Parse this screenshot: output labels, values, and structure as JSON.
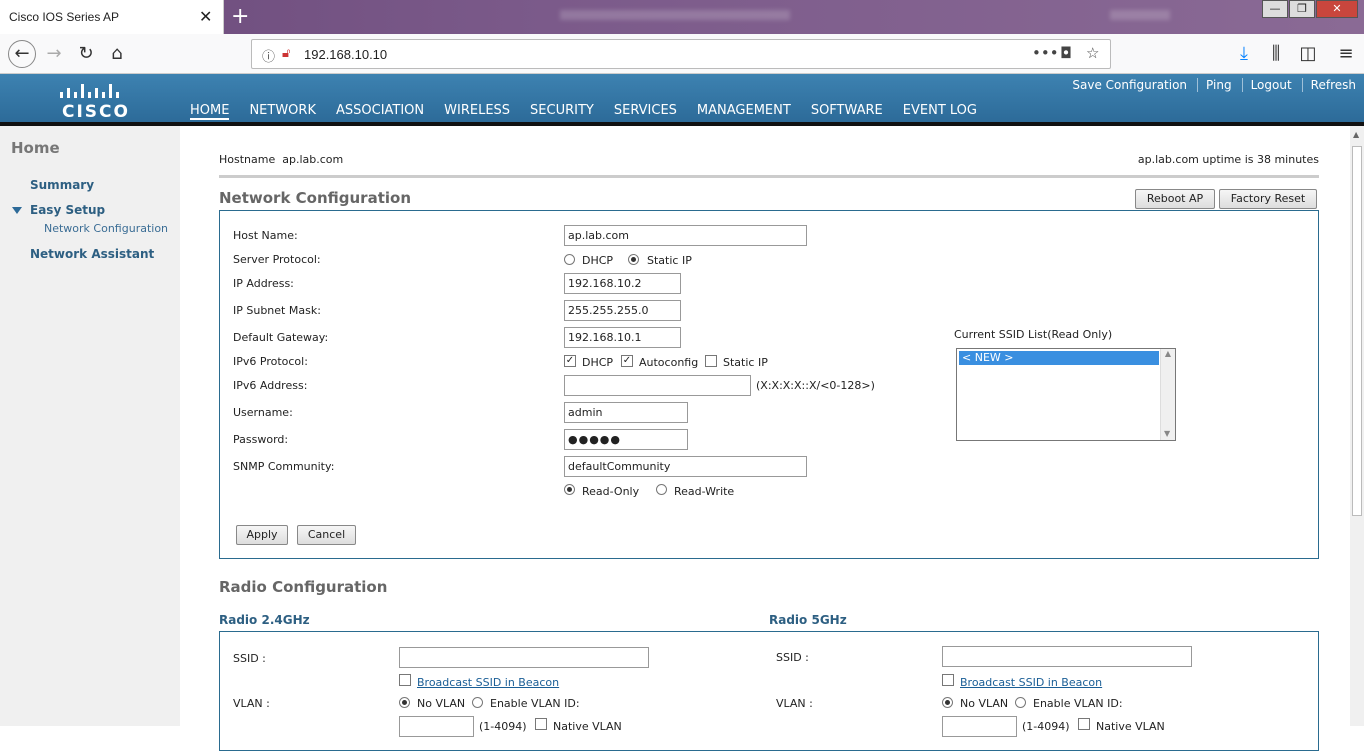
{
  "browser": {
    "tab_title": "Cisco IOS Series AP",
    "url": "192.168.10.10"
  },
  "cisco": {
    "logo_text": "CISCO",
    "nav": [
      "HOME",
      "NETWORK",
      "ASSOCIATION",
      "WIRELESS",
      "SECURITY",
      "SERVICES",
      "MANAGEMENT",
      "SOFTWARE",
      "EVENT LOG"
    ],
    "top_links": [
      "Save Configuration",
      "Ping",
      "Logout",
      "Refresh"
    ]
  },
  "sidebar": {
    "home": "Home",
    "summary": "Summary",
    "easy_setup": "Easy Setup",
    "network_configuration": "Network Configuration",
    "network_assistant": "Network Assistant"
  },
  "header": {
    "hostname_label": "Hostname",
    "hostname_value": "ap.lab.com",
    "uptime": "ap.lab.com uptime is 38 minutes"
  },
  "network_config": {
    "title": "Network Configuration",
    "reboot_label": "Reboot AP",
    "factory_reset_label": "Factory Reset",
    "host_name_label": "Host Name:",
    "host_name_value": "ap.lab.com",
    "server_protocol_label": "Server Protocol:",
    "dhcp_label": "DHCP",
    "static_ip_label": "Static IP",
    "server_protocol_selected": "Static IP",
    "ip_address_label": "IP Address:",
    "ip_address_value": "192.168.10.2",
    "subnet_label": "IP Subnet Mask:",
    "subnet_value": "255.255.255.0",
    "gateway_label": "Default Gateway:",
    "gateway_value": "192.168.10.1",
    "ipv6_protocol_label": "IPv6 Protocol:",
    "ipv6_dhcp_label": "DHCP",
    "ipv6_autoconfig_label": "Autoconfig",
    "ipv6_static_label": "Static IP",
    "ipv6_address_label": "IPv6 Address:",
    "ipv6_address_value": "",
    "ipv6_hint": "(X:X:X:X::X/<0-128>)",
    "username_label": "Username:",
    "username_value": "admin",
    "password_label": "Password:",
    "password_value": "●●●●●",
    "snmp_label": "SNMP Community:",
    "snmp_value": "defaultCommunity",
    "read_only_label": "Read-Only",
    "read_write_label": "Read-Write",
    "apply_label": "Apply",
    "cancel_label": "Cancel",
    "ssid_list_label": "Current SSID List(Read Only)",
    "ssid_list_items": [
      "< NEW >"
    ]
  },
  "radio_config": {
    "title": "Radio Configuration",
    "radio24_title": "Radio 2.4GHz",
    "radio5_title": "Radio 5GHz",
    "ssid_label": "SSID :",
    "broadcast_label": "Broadcast SSID in Beacon",
    "vlan_label": "VLAN :",
    "no_vlan_label": "No VLAN",
    "enable_vlan_label": "Enable VLAN ID:",
    "vlan_range": "(1-4094)",
    "native_vlan_label": "Native VLAN"
  }
}
